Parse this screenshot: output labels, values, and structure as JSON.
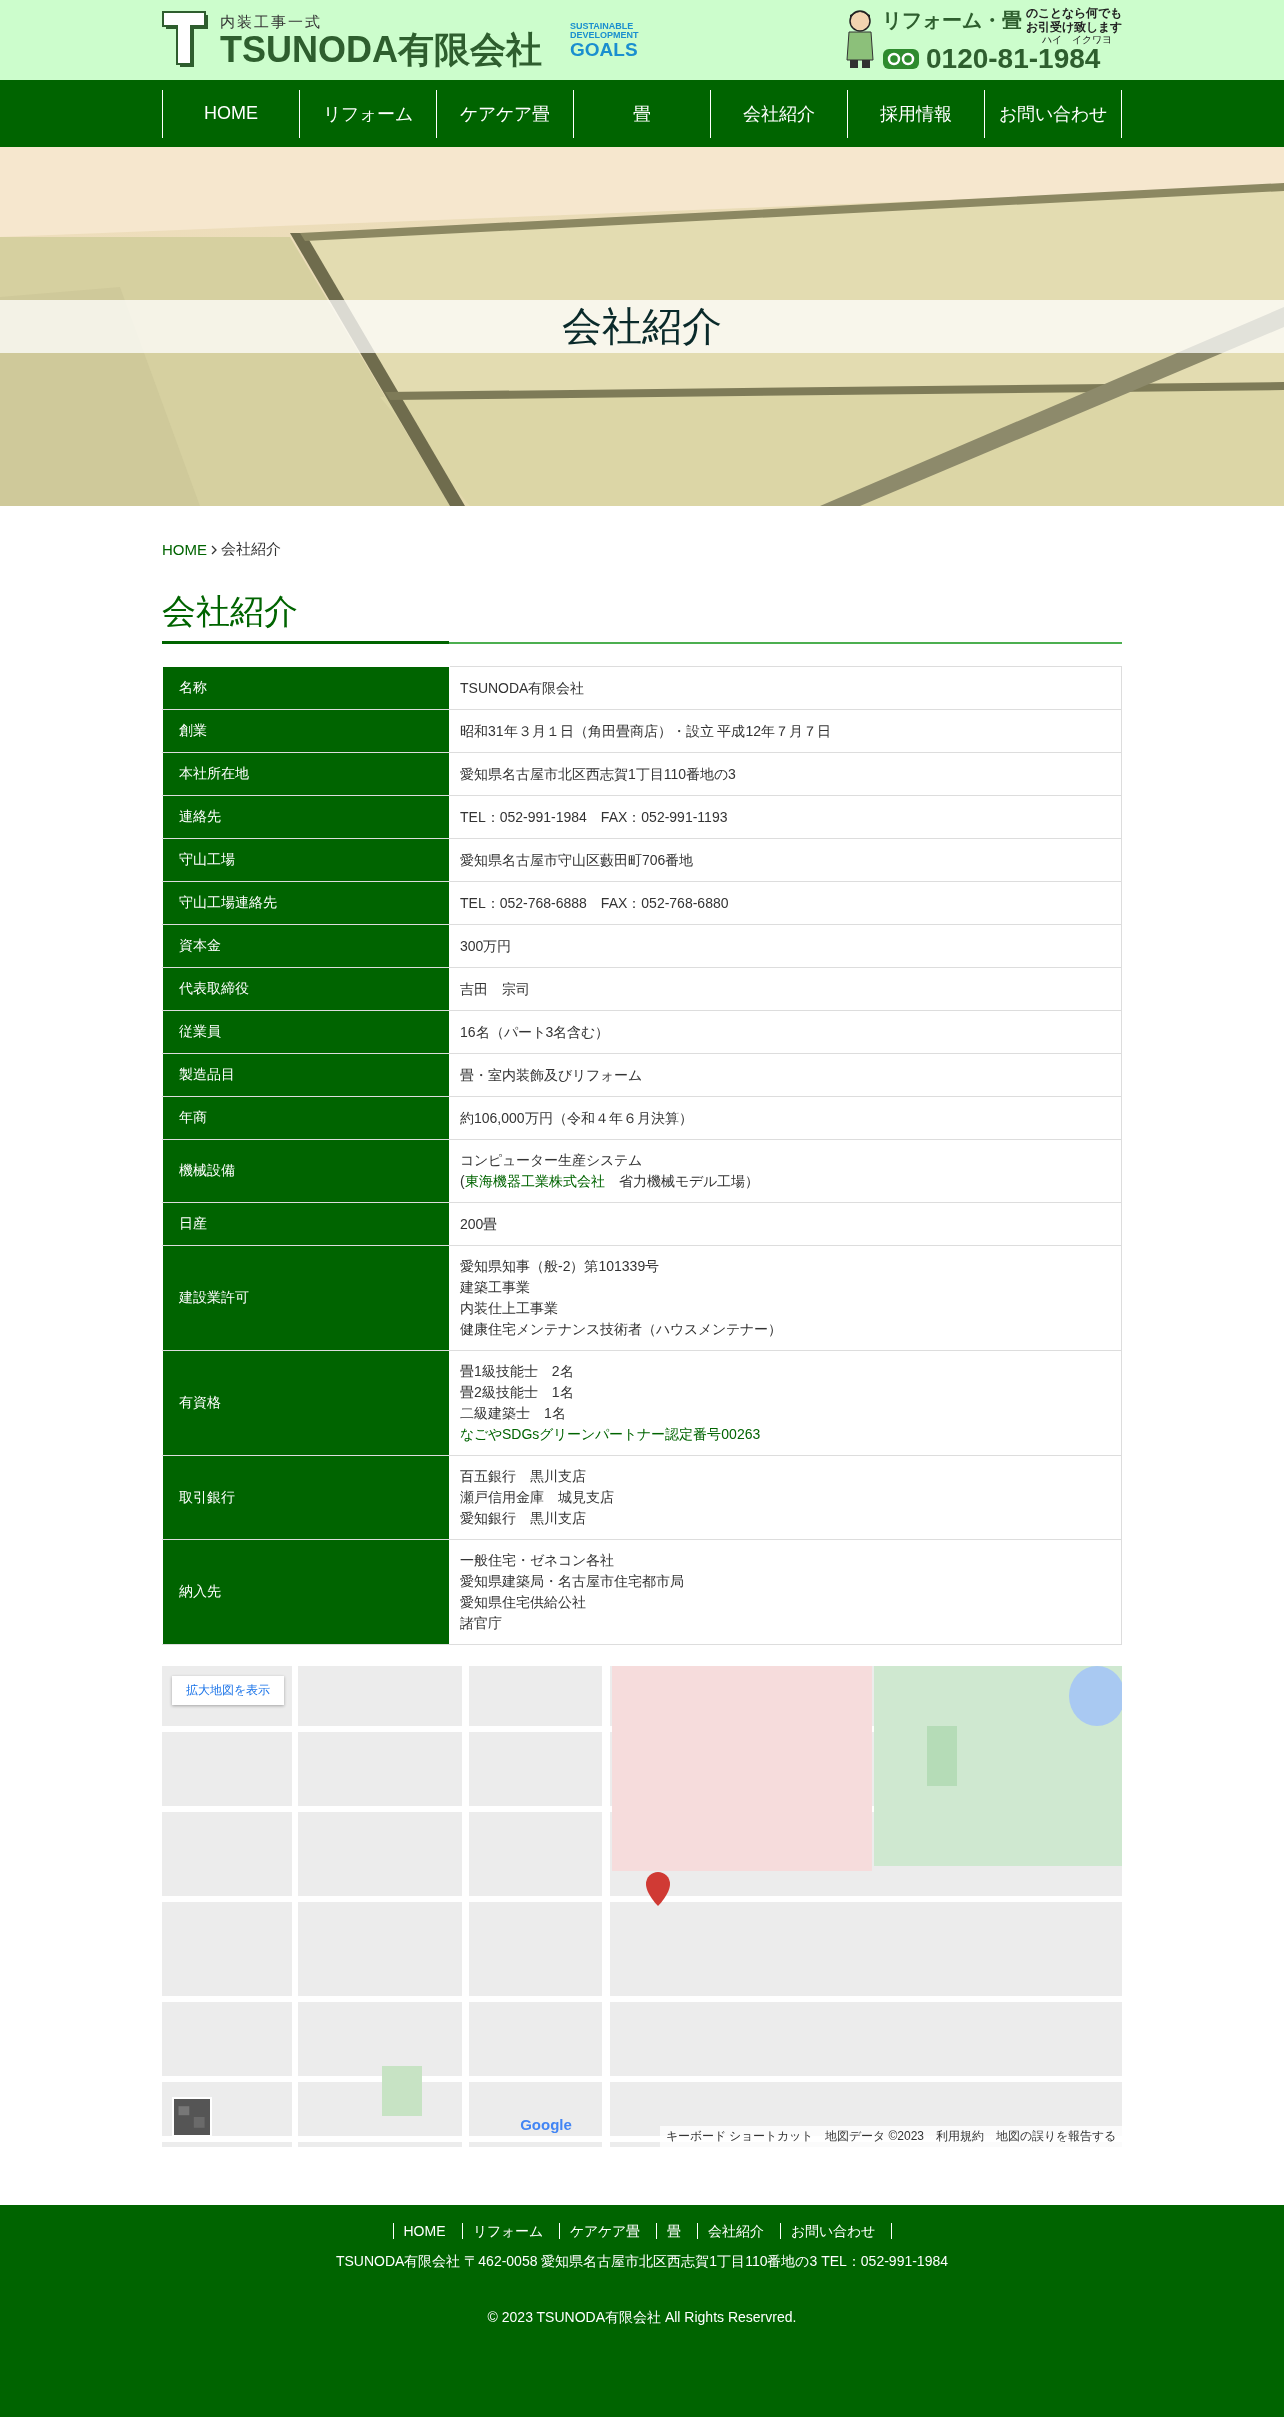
{
  "header": {
    "tagline": "内装工事一式",
    "company": "TSUNODA有限会社",
    "sdgs": [
      "SUSTAINABLE",
      "DEVELOPMENT",
      "GOALS"
    ],
    "promo_title": "リフォーム・畳",
    "promo_lines": [
      "のことなら何でも",
      "お引受け致します"
    ],
    "phone": "0120-81-1984",
    "phone_reading": "ハイ　イクワヨ"
  },
  "nav": [
    "HOME",
    "リフォーム",
    "ケアケア畳",
    "畳",
    "会社紹介",
    "採用情報",
    "お問い合わせ"
  ],
  "hero": {
    "title": "会社紹介"
  },
  "breadcrumb": {
    "home": "HOME",
    "current": "会社紹介"
  },
  "page_title": "会社紹介",
  "table": [
    {
      "label": "名称",
      "lines": [
        "TSUNODA有限会社"
      ]
    },
    {
      "label": "創業",
      "lines": [
        "昭和31年３月１日（角田畳商店）・設立 平成12年７月７日"
      ]
    },
    {
      "label": "本社所在地",
      "lines": [
        "愛知県名古屋市北区西志賀1丁目110番地の3"
      ]
    },
    {
      "label": "連絡先",
      "lines": [
        "TEL：052-991-1984　FAX：052-991-1193"
      ]
    },
    {
      "label": "守山工場",
      "lines": [
        "愛知県名古屋市守山区藪田町706番地"
      ]
    },
    {
      "label": "守山工場連絡先",
      "lines": [
        "TEL：052-768-6888　FAX：052-768-6880"
      ]
    },
    {
      "label": "資本金",
      "lines": [
        "300万円"
      ]
    },
    {
      "label": "代表取締役",
      "lines": [
        "吉田　宗司"
      ]
    },
    {
      "label": "従業員",
      "lines": [
        "16名（パート3名含む）"
      ]
    },
    {
      "label": "製造品目",
      "lines": [
        "畳・室内装飾及びリフォーム"
      ]
    },
    {
      "label": "年商",
      "lines": [
        "約106,000万円（令和４年６月決算）"
      ]
    },
    {
      "label": "機械設備",
      "lines": [
        "コンピューター生産システム",
        {
          "segments": [
            {
              "text": "(",
              "link": false
            },
            {
              "text": "東海機器工業株式会社",
              "link": true
            },
            {
              "text": "　省力機械モデル工場）",
              "link": false
            }
          ]
        }
      ]
    },
    {
      "label": "日産",
      "lines": [
        "200畳"
      ]
    },
    {
      "label": "建設業許可",
      "lines": [
        "愛知県知事（般-2）第101339号",
        "建築工事業",
        "内装仕上工事業",
        "健康住宅メンテナンス技術者（ハウスメンテナー）"
      ]
    },
    {
      "label": "有資格",
      "lines": [
        "畳1級技能士　2名",
        "畳2級技能士　1名",
        "二級建築士　1名",
        {
          "segments": [
            {
              "text": "なごやSDGsグリーンパートナー認定番号00263",
              "link": true
            }
          ]
        }
      ]
    },
    {
      "label": "取引銀行",
      "lines": [
        "百五銀行　黒川支店",
        "瀬戸信用金庫　城見支店",
        "愛知銀行　黒川支店"
      ]
    },
    {
      "label": "納入先",
      "lines": [
        "一般住宅・ゼネコン各社",
        "愛知県建築局・名古屋市住宅都市局",
        "愛知県住宅供給公社",
        "諸官庁"
      ]
    }
  ],
  "map": {
    "kind": "picture",
    "enlarge_button": "拡大地図を表示",
    "logo": "Google",
    "attribution": [
      "キーボード ショートカット",
      "地図データ ©2023",
      "利用規約",
      "地図の誤りを報告する"
    ]
  },
  "footer": {
    "links": [
      "HOME",
      "リフォーム",
      "ケアケア畳",
      "畳",
      "会社紹介",
      "お問い合わせ"
    ],
    "address": "TSUNODA有限会社 〒462-0058 愛知県名古屋市北区西志賀1丁目110番地の3 TEL：052-991-1984",
    "copyright": "© 2023 TSUNODA有限会社 All Rights Reservred."
  }
}
